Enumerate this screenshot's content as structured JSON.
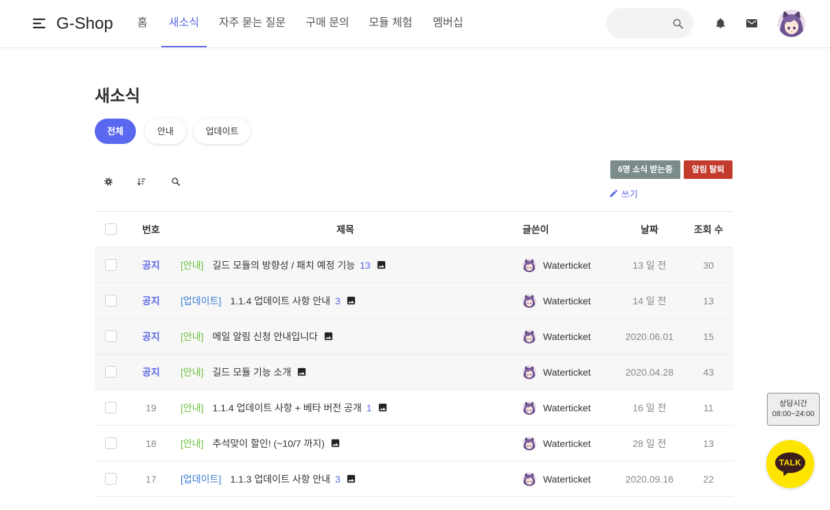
{
  "header": {
    "logo": "G-Shop",
    "nav": [
      {
        "label": "홈",
        "active": false
      },
      {
        "label": "새소식",
        "active": true
      },
      {
        "label": "자주 묻는 질문",
        "active": false
      },
      {
        "label": "구매 문의",
        "active": false
      },
      {
        "label": "모듈 체험",
        "active": false
      },
      {
        "label": "멤버십",
        "active": false
      }
    ],
    "search": {
      "value": ""
    }
  },
  "page": {
    "title": "새소식",
    "tabs": [
      {
        "label": "전체",
        "active": true
      },
      {
        "label": "안내",
        "active": false
      },
      {
        "label": "업데이트",
        "active": false
      }
    ],
    "subscribers_label": "6명 소식 받는중",
    "unsubscribe_label": "알림 탈퇴",
    "write_label": "쓰기"
  },
  "table": {
    "columns": {
      "number": "번호",
      "title": "제목",
      "author": "글쓴이",
      "date": "날짜",
      "views": "조회 수"
    },
    "rows": [
      {
        "number": "공지",
        "notice": true,
        "category": "[안내]",
        "category_color": "#6cc13d",
        "title": "길드 모듈의 방향성 / 패치 예정 기능",
        "comments": "13",
        "has_image": true,
        "author": "Waterticket",
        "date": "13 일 전",
        "views": "30"
      },
      {
        "number": "공지",
        "notice": true,
        "category": "[업데이트]",
        "category_color": "#3a7ad6",
        "title": "1.1.4 업데이트 사항 안내",
        "comments": "3",
        "has_image": true,
        "author": "Waterticket",
        "date": "14 일 전",
        "views": "13"
      },
      {
        "number": "공지",
        "notice": true,
        "category": "[안내]",
        "category_color": "#6cc13d",
        "title": "메일 알림 신청 안내입니다",
        "has_image": true,
        "author": "Waterticket",
        "date": "2020.06.01",
        "views": "15"
      },
      {
        "number": "공지",
        "notice": true,
        "category": "[안내]",
        "category_color": "#6cc13d",
        "title": "길드 모듈 기능 소개",
        "has_image": true,
        "author": "Waterticket",
        "date": "2020.04.28",
        "views": "43"
      },
      {
        "number": "19",
        "notice": false,
        "category": "[안내]",
        "category_color": "#6cc13d",
        "title": "1.1.4 업데이트 사항 + 베타 버전 공개",
        "comments": "1",
        "has_image": true,
        "author": "Waterticket",
        "date": "16 일 전",
        "views": "11"
      },
      {
        "number": "18",
        "notice": false,
        "category": "[안내]",
        "category_color": "#6cc13d",
        "title": "추석맞이 할인! (~10/7 까지)",
        "has_image": true,
        "author": "Waterticket",
        "date": "28 일 전",
        "views": "13"
      },
      {
        "number": "17",
        "notice": false,
        "category": "[업데이트]",
        "category_color": "#3a7ad6",
        "title": "1.1.3 업데이트 사항 안내",
        "comments": "3",
        "has_image": true,
        "author": "Waterticket",
        "date": "2020.09.16",
        "views": "22"
      }
    ]
  },
  "widgets": {
    "consult": {
      "label": "상담시간",
      "hours": "08:00~24:00"
    },
    "kakao": {
      "label": "TALK"
    }
  },
  "icons": {
    "menu": "menu-icon",
    "search": "search-icon",
    "notifications": "bell-icon",
    "messages": "envelope-icon",
    "settings": "gear-icon",
    "sort": "sort-icon",
    "board_search": "search-icon",
    "write": "pencil-icon",
    "attachment": "image-icon"
  },
  "colors": {
    "accent": "#5a67e8",
    "tab_active": "#5a68f0",
    "notice_row": "#f7f7f7",
    "subscriber_badge": "#7c8b8b",
    "unsubscribe": "#c23b2c",
    "kakao": "#fee500"
  }
}
